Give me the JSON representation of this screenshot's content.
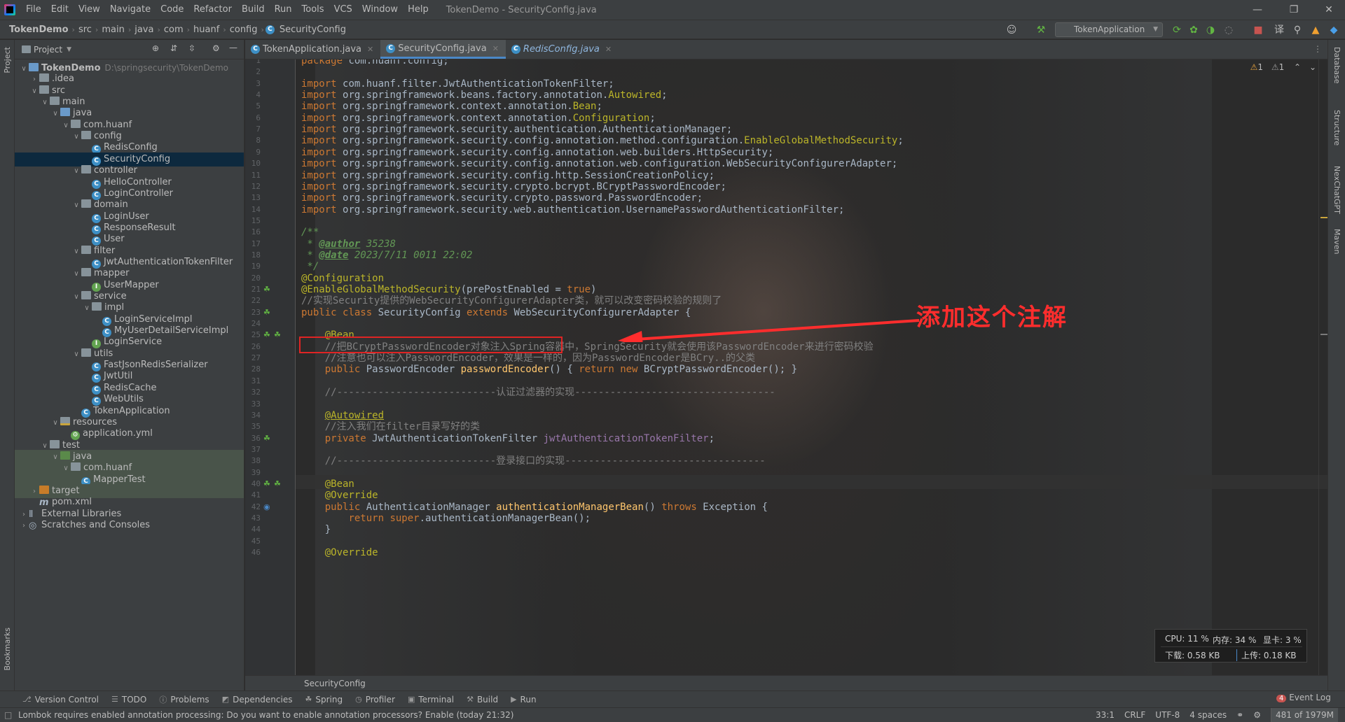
{
  "window": {
    "title": "TokenDemo - SecurityConfig.java",
    "menu": [
      "File",
      "Edit",
      "View",
      "Navigate",
      "Code",
      "Refactor",
      "Build",
      "Run",
      "Tools",
      "VCS",
      "Window",
      "Help"
    ]
  },
  "navbar": {
    "crumbs": [
      "TokenDemo",
      "src",
      "main",
      "java",
      "com",
      "huanf",
      "config",
      "SecurityConfig"
    ],
    "run_config": "TokenApplication"
  },
  "left_stripe": {
    "project": "Project",
    "bookmarks": "Bookmarks"
  },
  "right_stripe": [
    "Database",
    "Structure",
    "NexChatGPT",
    "Maven"
  ],
  "project_panel": {
    "header": "Project",
    "tree": [
      {
        "label": "TokenDemo",
        "extra": "D:\\springsecurity\\TokenDemo",
        "depth": 0,
        "icon": "folder-module",
        "expanded": true
      },
      {
        "label": ".idea",
        "depth": 1,
        "icon": "folder",
        "expanded": false
      },
      {
        "label": "src",
        "depth": 1,
        "icon": "folder",
        "expanded": true
      },
      {
        "label": "main",
        "depth": 2,
        "icon": "folder",
        "expanded": true
      },
      {
        "label": "java",
        "depth": 3,
        "icon": "folder-blue",
        "expanded": true
      },
      {
        "label": "com.huanf",
        "depth": 4,
        "icon": "folder",
        "expanded": true
      },
      {
        "label": "config",
        "depth": 5,
        "icon": "folder",
        "expanded": true
      },
      {
        "label": "RedisConfig",
        "depth": 6,
        "icon": "class"
      },
      {
        "label": "SecurityConfig",
        "depth": 6,
        "icon": "class",
        "selected": true
      },
      {
        "label": "controller",
        "depth": 5,
        "icon": "folder",
        "expanded": true
      },
      {
        "label": "HelloController",
        "depth": 6,
        "icon": "class"
      },
      {
        "label": "LoginController",
        "depth": 6,
        "icon": "class"
      },
      {
        "label": "domain",
        "depth": 5,
        "icon": "folder",
        "expanded": true
      },
      {
        "label": "LoginUser",
        "depth": 6,
        "icon": "class"
      },
      {
        "label": "ResponseResult",
        "depth": 6,
        "icon": "class"
      },
      {
        "label": "User",
        "depth": 6,
        "icon": "class"
      },
      {
        "label": "filter",
        "depth": 5,
        "icon": "folder",
        "expanded": true
      },
      {
        "label": "JwtAuthenticationTokenFilter",
        "depth": 6,
        "icon": "class"
      },
      {
        "label": "mapper",
        "depth": 5,
        "icon": "folder",
        "expanded": true
      },
      {
        "label": "UserMapper",
        "depth": 6,
        "icon": "interface"
      },
      {
        "label": "service",
        "depth": 5,
        "icon": "folder",
        "expanded": true
      },
      {
        "label": "impl",
        "depth": 6,
        "icon": "folder",
        "expanded": true
      },
      {
        "label": "LoginServiceImpl",
        "depth": 7,
        "icon": "class"
      },
      {
        "label": "MyUserDetailServiceImpl",
        "depth": 7,
        "icon": "class"
      },
      {
        "label": "LoginService",
        "depth": 6,
        "icon": "interface"
      },
      {
        "label": "utils",
        "depth": 5,
        "icon": "folder",
        "expanded": true
      },
      {
        "label": "FastJsonRedisSerializer",
        "depth": 6,
        "icon": "class"
      },
      {
        "label": "JwtUtil",
        "depth": 6,
        "icon": "class"
      },
      {
        "label": "RedisCache",
        "depth": 6,
        "icon": "class"
      },
      {
        "label": "WebUtils",
        "depth": 6,
        "icon": "class"
      },
      {
        "label": "TokenApplication",
        "depth": 5,
        "icon": "class"
      },
      {
        "label": "resources",
        "depth": 3,
        "icon": "folder-res",
        "expanded": true
      },
      {
        "label": "application.yml",
        "depth": 4,
        "icon": "yml"
      },
      {
        "label": "test",
        "depth": 2,
        "icon": "folder",
        "expanded": true
      },
      {
        "label": "java",
        "depth": 3,
        "icon": "folder-green",
        "expanded": true,
        "test": true
      },
      {
        "label": "com.huanf",
        "depth": 4,
        "icon": "folder",
        "expanded": true,
        "test": true
      },
      {
        "label": "MapperTest",
        "depth": 5,
        "icon": "class",
        "test": true
      },
      {
        "label": "target",
        "depth": 1,
        "icon": "folder-orange",
        "expanded": false,
        "test": true
      },
      {
        "label": "pom.xml",
        "depth": 1,
        "icon": "maven"
      },
      {
        "label": "External Libraries",
        "depth": 0,
        "icon": "libs",
        "expanded": false
      },
      {
        "label": "Scratches and Consoles",
        "depth": 0,
        "icon": "scratch",
        "expanded": false
      }
    ]
  },
  "tabs": [
    {
      "label": "TokenApplication.java",
      "active": false
    },
    {
      "label": "SecurityConfig.java",
      "active": true
    },
    {
      "label": "RedisConfig.java",
      "active": false,
      "italic": true
    }
  ],
  "inspections": {
    "warnings_a": "1",
    "warnings_b": "1"
  },
  "code": [
    {
      "n": "1",
      "html": "<span class=\"kw\">package </span>com.huanf.config;"
    },
    {
      "n": "2",
      "html": ""
    },
    {
      "n": "3",
      "html": "<span class=\"kw\">import </span>com.huanf.filter.JwtAuthenticationTokenFilter;"
    },
    {
      "n": "4",
      "html": "<span class=\"kw\">import </span>org.springframework.beans.factory.annotation.<span class=\"ann\">Autowired</span>;"
    },
    {
      "n": "5",
      "html": "<span class=\"kw\">import </span>org.springframework.context.annotation.<span class=\"ann\">Bean</span>;"
    },
    {
      "n": "6",
      "html": "<span class=\"kw\">import </span>org.springframework.context.annotation.<span class=\"ann\">Configuration</span>;"
    },
    {
      "n": "7",
      "html": "<span class=\"kw\">import </span>org.springframework.security.authentication.AuthenticationManager;"
    },
    {
      "n": "8",
      "html": "<span class=\"kw\">import </span>org.springframework.security.config.annotation.method.configuration.<span class=\"ann\">EnableGlobalMethodSecurity</span>;"
    },
    {
      "n": "9",
      "html": "<span class=\"kw\">import </span>org.springframework.security.config.annotation.web.builders.HttpSecurity;"
    },
    {
      "n": "10",
      "html": "<span class=\"kw\">import </span>org.springframework.security.config.annotation.web.configuration.WebSecurityConfigurerAdapter;"
    },
    {
      "n": "11",
      "html": "<span class=\"kw\">import </span>org.springframework.security.config.http.SessionCreationPolicy;"
    },
    {
      "n": "12",
      "html": "<span class=\"kw\">import </span>org.springframework.security.crypto.bcrypt.BCryptPasswordEncoder;"
    },
    {
      "n": "13",
      "html": "<span class=\"kw\">import </span>org.springframework.security.crypto.password.PasswordEncoder;"
    },
    {
      "n": "14",
      "html": "<span class=\"kw\">import </span>org.springframework.security.web.authentication.UsernamePasswordAuthenticationFilter;"
    },
    {
      "n": "15",
      "html": ""
    },
    {
      "n": "16",
      "html": "<span class=\"doc\">/**</span>"
    },
    {
      "n": "17",
      "html": "<span class=\"doc\"> * </span><span class=\"doctag\">@author</span><span class=\"doc\"> 35238</span>"
    },
    {
      "n": "18",
      "html": "<span class=\"doc\"> * </span><span class=\"doctag\">@date</span><span class=\"doc\"> 2023/7/11 0011 22:02</span>"
    },
    {
      "n": "19",
      "html": "<span class=\"doc\"> */</span>"
    },
    {
      "n": "20",
      "html": "<span class=\"ann\">@Configuration</span>"
    },
    {
      "n": "21",
      "html": "<span class=\"ann\">@EnableGlobalMethodSecurity</span>(prePostEnabled = <span class=\"kw\">true</span>)"
    },
    {
      "n": "22",
      "html": "<span class=\"cmt\">//实现Security提供的WebSecurityConfigurerAdapter类，就可以改变密码校验的规则了</span>"
    },
    {
      "n": "23",
      "html": "<span class=\"kw\">public class </span>SecurityConfig <span class=\"kw\">extends </span>WebSecurityConfigurerAdapter {"
    },
    {
      "n": "24",
      "html": ""
    },
    {
      "n": "25",
      "html": "    <span class=\"ann\">@Bean</span>"
    },
    {
      "n": "26",
      "html": "    <span class=\"cmt\">//把BCryptPasswordEncoder对象注入Spring容器中，SpringSecurity就会使用该PasswordEncoder来进行密码校验</span>"
    },
    {
      "n": "27",
      "html": "    <span class=\"cmt\">//注意也可以注入PasswordEncoder，效果是一样的，因为PasswordEncoder是BCry..的父类</span>"
    },
    {
      "n": "28",
      "html": "    <span class=\"kw\">public </span>PasswordEncoder <span class=\"mth\">passwordEncoder</span>() { <span class=\"kw\">return new </span>BCryptPasswordEncoder(); }"
    },
    {
      "n": "31",
      "html": ""
    },
    {
      "n": "32",
      "html": "    <span class=\"cmt\">//---------------------------认证过滤器的实现----------------------------------</span>"
    },
    {
      "n": "33",
      "html": ""
    },
    {
      "n": "34",
      "html": "    <span class=\"cls-ann\">@Autowired</span>"
    },
    {
      "n": "35",
      "html": "    <span class=\"cmt\">//注入我们在filter目录写好的类</span>"
    },
    {
      "n": "36",
      "html": "    <span class=\"kw\">private </span>JwtAuthenticationTokenFilter <span class=\"fld\">jwtAuthenticationTokenFilter</span>;"
    },
    {
      "n": "37",
      "html": ""
    },
    {
      "n": "38",
      "html": "    <span class=\"cmt\">//---------------------------登录接口的实现----------------------------------</span>"
    },
    {
      "n": "39",
      "html": ""
    },
    {
      "n": "40",
      "html": "    <span class=\"ann\">@Bean</span>"
    },
    {
      "n": "41",
      "html": "    <span class=\"ann\">@Override</span>"
    },
    {
      "n": "42",
      "html": "    <span class=\"kw\">public </span>AuthenticationManager <span class=\"mth\">authenticationManagerBean</span>() <span class=\"kw\">throws </span>Exception {"
    },
    {
      "n": "43",
      "html": "        <span class=\"kw\">return super</span>.authenticationManagerBean();"
    },
    {
      "n": "44",
      "html": "    }"
    },
    {
      "n": "45",
      "html": ""
    },
    {
      "n": "46",
      "html": "    <span class=\"ann\">@Override</span>"
    }
  ],
  "annotation_callout": "添加这个注解",
  "editor_breadcrumb": "SecurityConfig",
  "net_widget": {
    "cpu": "CPU: 11 %",
    "mem": "内存: 34 %",
    "gpu": "显卡: 3 %",
    "down": "下载: 0.58 KB",
    "up": "上传: 0.18 KB"
  },
  "tool_windows": [
    "Version Control",
    "TODO",
    "Problems",
    "Dependencies",
    "Spring",
    "Profiler",
    "Terminal",
    "Build",
    "Run"
  ],
  "event_log": {
    "count": "4",
    "label": "Event Log"
  },
  "status": {
    "message": "Lombok requires enabled annotation processing: Do you want to enable annotation processors? Enable (today 21:32)",
    "position": "33:1",
    "line_sep": "CRLF",
    "encoding": "UTF-8",
    "indent": "4 spaces",
    "memory": "481 of 1979M"
  }
}
